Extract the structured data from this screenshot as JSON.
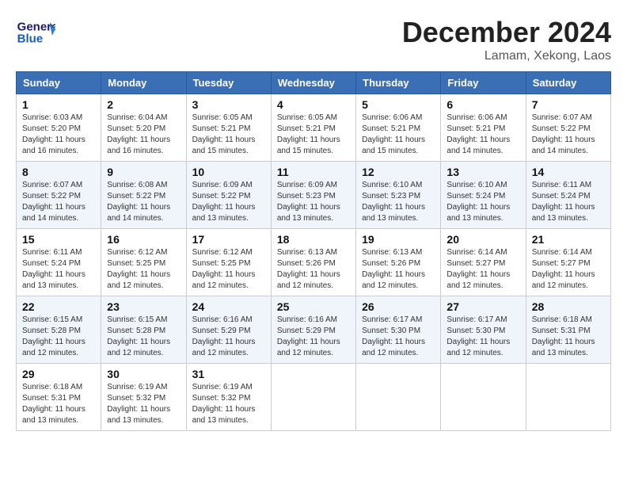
{
  "logo": {
    "line1": "General",
    "line2": "Blue"
  },
  "title": {
    "month_year": "December 2024",
    "location": "Lamam, Xekong, Laos"
  },
  "headers": [
    "Sunday",
    "Monday",
    "Tuesday",
    "Wednesday",
    "Thursday",
    "Friday",
    "Saturday"
  ],
  "weeks": [
    [
      {
        "day": "1",
        "sunrise": "6:03 AM",
        "sunset": "5:20 PM",
        "daylight": "11 hours and 16 minutes."
      },
      {
        "day": "2",
        "sunrise": "6:04 AM",
        "sunset": "5:20 PM",
        "daylight": "11 hours and 16 minutes."
      },
      {
        "day": "3",
        "sunrise": "6:05 AM",
        "sunset": "5:21 PM",
        "daylight": "11 hours and 15 minutes."
      },
      {
        "day": "4",
        "sunrise": "6:05 AM",
        "sunset": "5:21 PM",
        "daylight": "11 hours and 15 minutes."
      },
      {
        "day": "5",
        "sunrise": "6:06 AM",
        "sunset": "5:21 PM",
        "daylight": "11 hours and 15 minutes."
      },
      {
        "day": "6",
        "sunrise": "6:06 AM",
        "sunset": "5:21 PM",
        "daylight": "11 hours and 14 minutes."
      },
      {
        "day": "7",
        "sunrise": "6:07 AM",
        "sunset": "5:22 PM",
        "daylight": "11 hours and 14 minutes."
      }
    ],
    [
      {
        "day": "8",
        "sunrise": "6:07 AM",
        "sunset": "5:22 PM",
        "daylight": "11 hours and 14 minutes."
      },
      {
        "day": "9",
        "sunrise": "6:08 AM",
        "sunset": "5:22 PM",
        "daylight": "11 hours and 14 minutes."
      },
      {
        "day": "10",
        "sunrise": "6:09 AM",
        "sunset": "5:22 PM",
        "daylight": "11 hours and 13 minutes."
      },
      {
        "day": "11",
        "sunrise": "6:09 AM",
        "sunset": "5:23 PM",
        "daylight": "11 hours and 13 minutes."
      },
      {
        "day": "12",
        "sunrise": "6:10 AM",
        "sunset": "5:23 PM",
        "daylight": "11 hours and 13 minutes."
      },
      {
        "day": "13",
        "sunrise": "6:10 AM",
        "sunset": "5:24 PM",
        "daylight": "11 hours and 13 minutes."
      },
      {
        "day": "14",
        "sunrise": "6:11 AM",
        "sunset": "5:24 PM",
        "daylight": "11 hours and 13 minutes."
      }
    ],
    [
      {
        "day": "15",
        "sunrise": "6:11 AM",
        "sunset": "5:24 PM",
        "daylight": "11 hours and 13 minutes."
      },
      {
        "day": "16",
        "sunrise": "6:12 AM",
        "sunset": "5:25 PM",
        "daylight": "11 hours and 12 minutes."
      },
      {
        "day": "17",
        "sunrise": "6:12 AM",
        "sunset": "5:25 PM",
        "daylight": "11 hours and 12 minutes."
      },
      {
        "day": "18",
        "sunrise": "6:13 AM",
        "sunset": "5:26 PM",
        "daylight": "11 hours and 12 minutes."
      },
      {
        "day": "19",
        "sunrise": "6:13 AM",
        "sunset": "5:26 PM",
        "daylight": "11 hours and 12 minutes."
      },
      {
        "day": "20",
        "sunrise": "6:14 AM",
        "sunset": "5:27 PM",
        "daylight": "11 hours and 12 minutes."
      },
      {
        "day": "21",
        "sunrise": "6:14 AM",
        "sunset": "5:27 PM",
        "daylight": "11 hours and 12 minutes."
      }
    ],
    [
      {
        "day": "22",
        "sunrise": "6:15 AM",
        "sunset": "5:28 PM",
        "daylight": "11 hours and 12 minutes."
      },
      {
        "day": "23",
        "sunrise": "6:15 AM",
        "sunset": "5:28 PM",
        "daylight": "11 hours and 12 minutes."
      },
      {
        "day": "24",
        "sunrise": "6:16 AM",
        "sunset": "5:29 PM",
        "daylight": "11 hours and 12 minutes."
      },
      {
        "day": "25",
        "sunrise": "6:16 AM",
        "sunset": "5:29 PM",
        "daylight": "11 hours and 12 minutes."
      },
      {
        "day": "26",
        "sunrise": "6:17 AM",
        "sunset": "5:30 PM",
        "daylight": "11 hours and 12 minutes."
      },
      {
        "day": "27",
        "sunrise": "6:17 AM",
        "sunset": "5:30 PM",
        "daylight": "11 hours and 12 minutes."
      },
      {
        "day": "28",
        "sunrise": "6:18 AM",
        "sunset": "5:31 PM",
        "daylight": "11 hours and 13 minutes."
      }
    ],
    [
      {
        "day": "29",
        "sunrise": "6:18 AM",
        "sunset": "5:31 PM",
        "daylight": "11 hours and 13 minutes."
      },
      {
        "day": "30",
        "sunrise": "6:19 AM",
        "sunset": "5:32 PM",
        "daylight": "11 hours and 13 minutes."
      },
      {
        "day": "31",
        "sunrise": "6:19 AM",
        "sunset": "5:32 PM",
        "daylight": "11 hours and 13 minutes."
      },
      null,
      null,
      null,
      null
    ]
  ]
}
